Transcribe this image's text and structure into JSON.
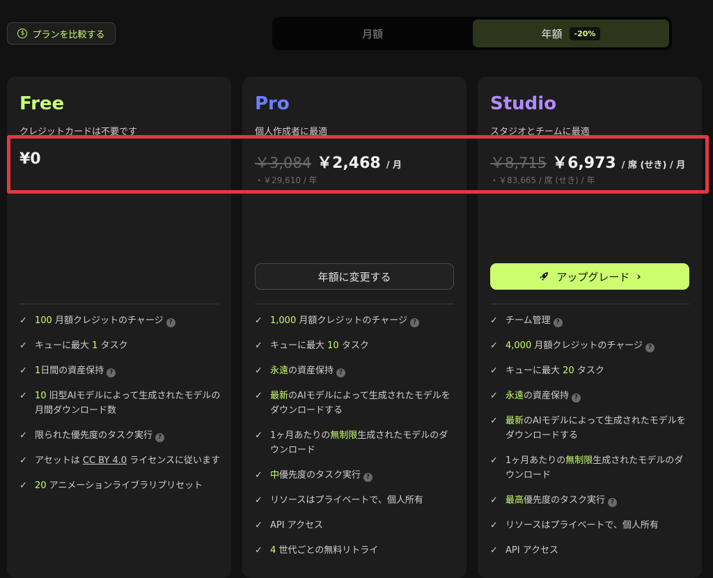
{
  "compare": {
    "label": "プランを比較する",
    "icon": "dollar-circle-icon"
  },
  "billing": {
    "monthly": "月額",
    "yearly": "年額",
    "discount": "-20%"
  },
  "colors": {
    "accent": "#c8ff6b",
    "pro": "#6c7dff",
    "studio": "#b08cff",
    "highlight": "#e13a3f"
  },
  "plans": [
    {
      "name": "Free",
      "desc": "クレジットカードは不要です",
      "price": "¥0",
      "features": [
        [
          "100",
          " 月額クレジットのチャージ"
        ],
        [
          "キューに最大 ",
          "1",
          " タスク"
        ],
        [
          "1",
          "日間の資産保持"
        ],
        [
          "10",
          " 旧型AIモデルによって生成されたモデルの月間ダウンロード数"
        ],
        [
          "限られた優先度のタスク実行"
        ],
        [
          "アセットは ",
          "CC BY 4.0",
          " ライセンスに従います"
        ],
        [
          "20",
          " アニメーションライブラリプリセット"
        ]
      ]
    },
    {
      "name": "Pro",
      "desc": "個人作成者に最適",
      "old_price": "￥3,084",
      "price": "￥2,468",
      "per": "/ 月",
      "sub_price": "・￥29,610 / 年",
      "button": "年額に変更する",
      "features": [
        [
          "1,000",
          " 月額クレジットのチャージ"
        ],
        [
          "キューに最大 ",
          "10",
          " タスク"
        ],
        [
          "永遠",
          "の資産保持"
        ],
        [
          "最新",
          "のAIモデルによって生成されたモデルをダウンロードする"
        ],
        [
          "1ヶ月あたりの",
          "無制限",
          "生成されたモデルのダウンロード"
        ],
        [
          "中",
          "優先度のタスク実行"
        ],
        [
          "リソースはプライベートで、個人所有"
        ],
        [
          "API アクセス"
        ],
        [
          "4",
          " 世代ごとの無料リトライ"
        ]
      ]
    },
    {
      "name": "Studio",
      "desc": "スタジオとチームに最適",
      "old_price": "￥8,715",
      "price": "￥6,973",
      "per": "/ 席 (せき) / 月",
      "sub_price": "・￥83,665 / 席 (せき) / 年",
      "button": "アップグレード",
      "features": [
        [
          "チーム管理"
        ],
        [
          "4,000",
          " 月額クレジットのチャージ"
        ],
        [
          "キューに最大 ",
          "20",
          " タスク"
        ],
        [
          "永遠",
          "の資産保持"
        ],
        [
          "最新",
          "のAIモデルによって生成されたモデルをダウンロードする"
        ],
        [
          "1ヶ月あたりの",
          "無制限",
          "生成されたモデルのダウンロード"
        ],
        [
          "最高",
          "優先度のタスク実行"
        ],
        [
          "リソースはプライベートで、個人所有"
        ],
        [
          "API アクセス"
        ]
      ]
    }
  ]
}
